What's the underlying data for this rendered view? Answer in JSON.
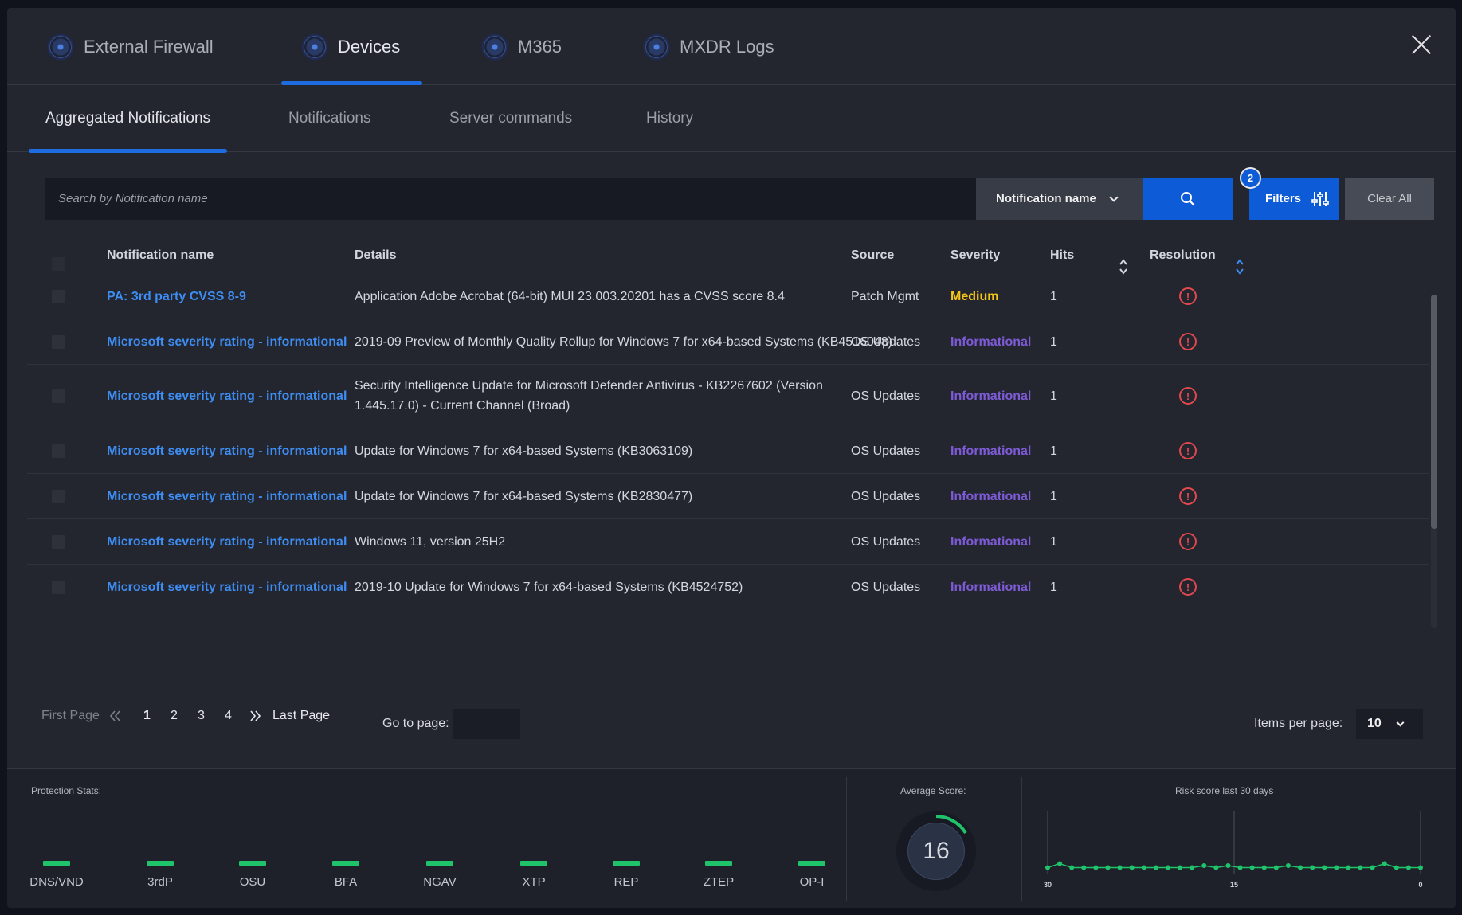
{
  "top_tabs": [
    "External Firewall",
    "Devices",
    "M365",
    "MXDR Logs"
  ],
  "sub_tabs": [
    "Aggregated Notifications",
    "Notifications",
    "Server commands",
    "History"
  ],
  "search": {
    "placeholder": "Search by Notification name",
    "field_select": "Notification name",
    "filters_label": "Filters",
    "filters_count": "2",
    "clear_label": "Clear All"
  },
  "table": {
    "headers": {
      "name": "Notification name",
      "details": "Details",
      "source": "Source",
      "severity": "Severity",
      "hits": "Hits",
      "resolution": "Resolution"
    },
    "rows": [
      {
        "name": "PA: 3rd party CVSS 8-9",
        "details": "Application Adobe Acrobat (64-bit) MUI 23.003.20201 has a CVSS score 8.4",
        "source": "Patch Mgmt",
        "severity": "Medium",
        "hits": "1"
      },
      {
        "name": "Microsoft severity rating - informational",
        "details": "2019-09 Preview of Monthly Quality Rollup for Windows 7 for x64-based Systems (KB4516048)",
        "source": "OS Updates",
        "severity": "Informational",
        "hits": "1"
      },
      {
        "name": "Microsoft severity rating - informational",
        "details": "Security Intelligence Update for Microsoft Defender Antivirus - KB2267602 (Version 1.445.17.0) - Current Channel (Broad)",
        "source": "OS Updates",
        "severity": "Informational",
        "hits": "1"
      },
      {
        "name": "Microsoft severity rating - informational",
        "details": "Update for Windows 7 for x64-based Systems (KB3063109)",
        "source": "OS Updates",
        "severity": "Informational",
        "hits": "1"
      },
      {
        "name": "Microsoft severity rating - informational",
        "details": "Update for Windows 7 for x64-based Systems (KB2830477)",
        "source": "OS Updates",
        "severity": "Informational",
        "hits": "1"
      },
      {
        "name": "Microsoft severity rating - informational",
        "details": "Windows 11, version 25H2",
        "source": "OS Updates",
        "severity": "Informational",
        "hits": "1"
      },
      {
        "name": "Microsoft severity rating - informational",
        "details": "2019-10 Update for Windows 7 for x64-based Systems (KB4524752)",
        "source": "OS Updates",
        "severity": "Informational",
        "hits": "1"
      }
    ]
  },
  "severity_colors": {
    "Medium": "#f5c518",
    "Informational": "#7e5bd6"
  },
  "pagination": {
    "first": "First Page",
    "pages": [
      "1",
      "2",
      "3",
      "4"
    ],
    "last": "Last Page",
    "goto_label": "Go to page:",
    "items_label": "Items per page:",
    "items_value": "10"
  },
  "stats": {
    "protection_title": "Protection Stats:",
    "protection_items": [
      "DNS/VND",
      "3rdP",
      "OSU",
      "BFA",
      "NGAV",
      "XTP",
      "REP",
      "ZTEP",
      "OP-I"
    ],
    "protection_color": "#1fc46a",
    "average_title": "Average Score:",
    "average_score": "16",
    "risk_title": "Risk score last 30 days"
  },
  "chart_data": {
    "type": "line",
    "title": "Risk score last 30 days",
    "x_ticks": [
      "30",
      "15",
      "0"
    ],
    "series": [
      {
        "values": [
          16,
          18,
          16,
          16,
          16,
          16,
          16,
          16,
          16,
          16,
          16,
          16,
          16,
          17,
          16,
          17,
          16,
          16,
          16,
          16,
          17,
          16,
          16,
          16,
          16,
          16,
          16,
          16,
          18,
          16,
          16,
          16
        ]
      }
    ]
  }
}
